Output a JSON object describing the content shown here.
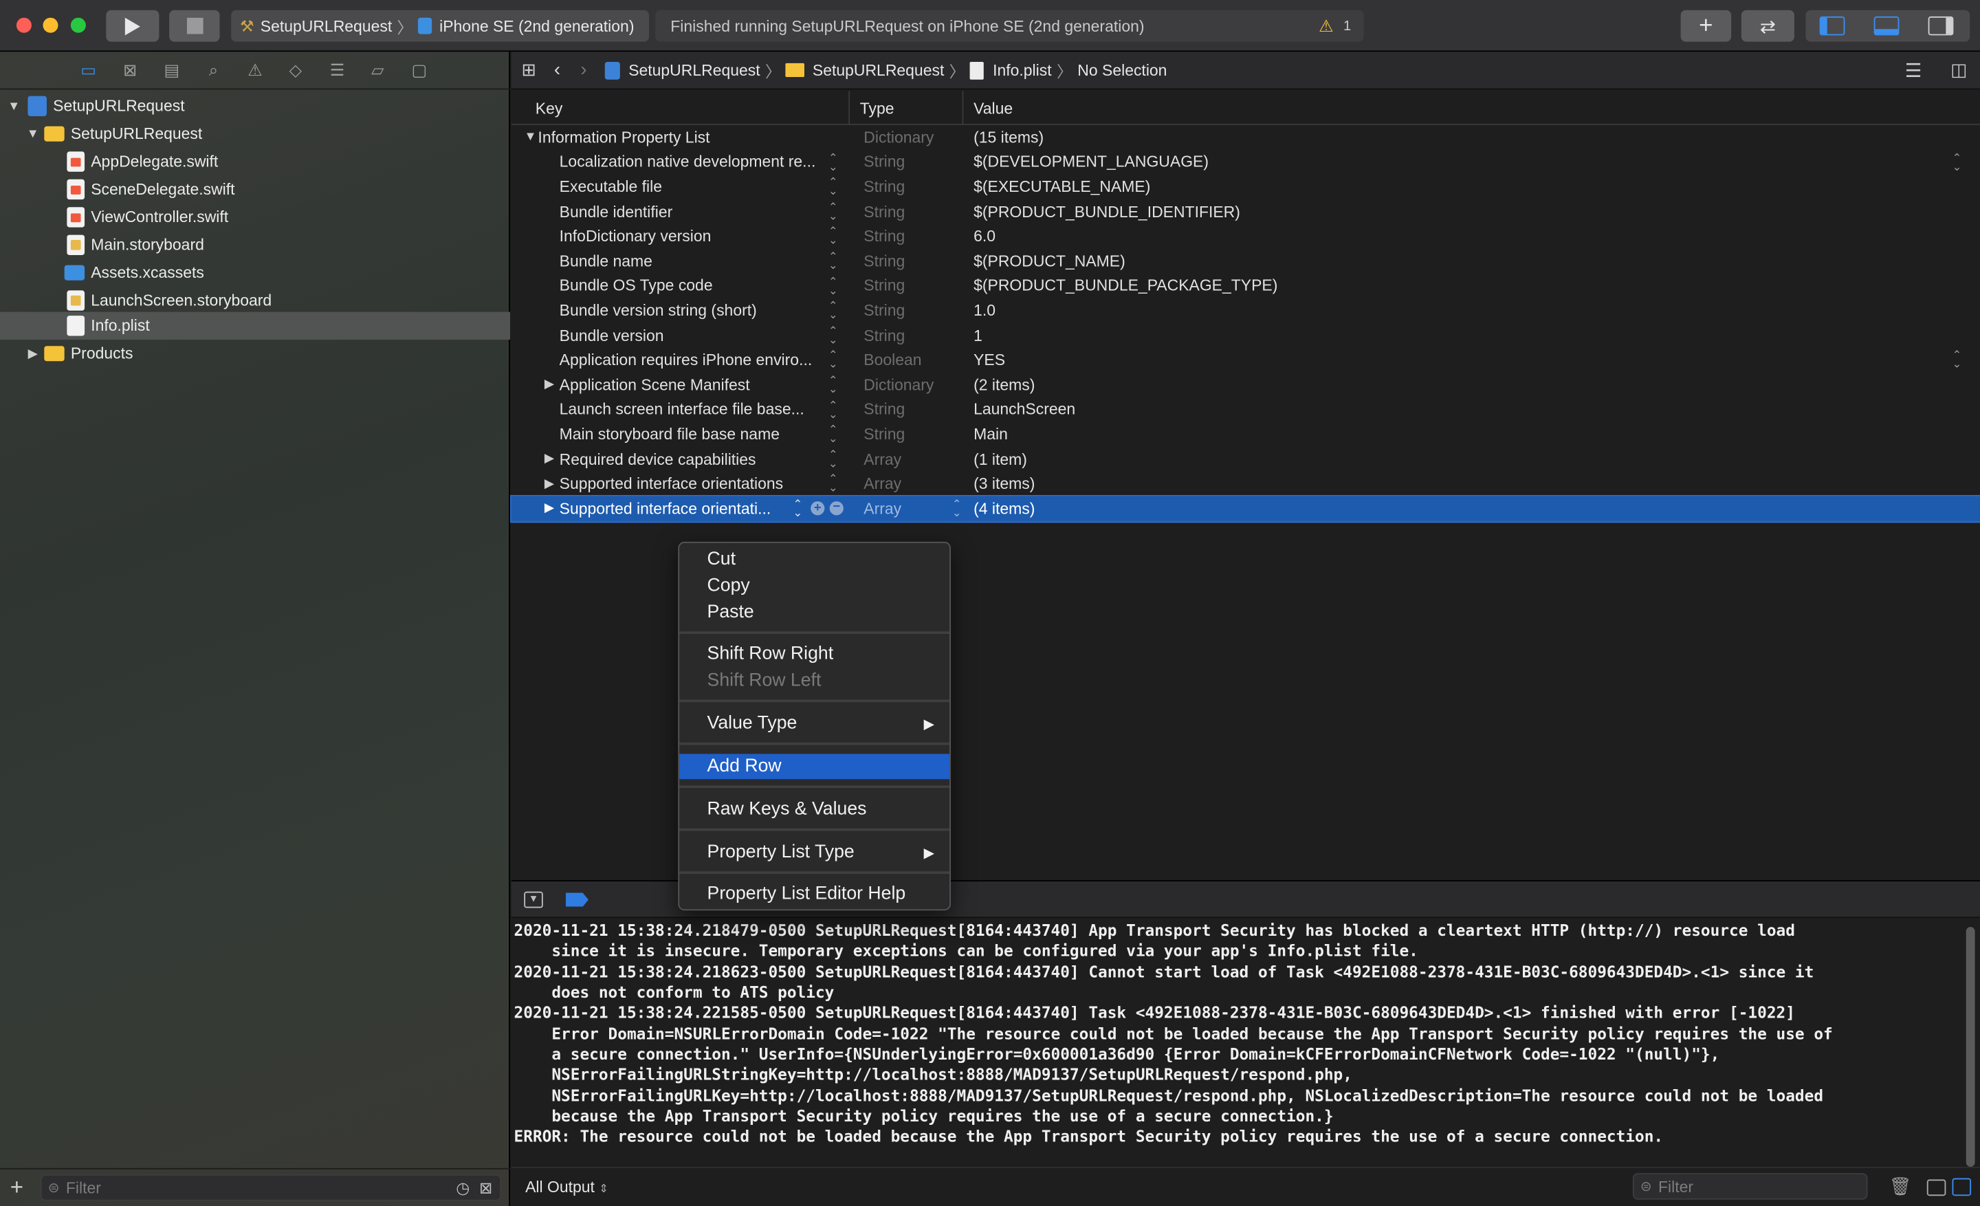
{
  "toolbar": {
    "scheme_target": "SetupURLRequest",
    "scheme_device": "iPhone SE (2nd generation)",
    "status_text": "Finished running SetupURLRequest on iPhone SE (2nd generation)",
    "warning_count": "1",
    "run_icon": "play-icon",
    "stop_icon": "stop-icon"
  },
  "navigator": {
    "icons": [
      "folder-icon",
      "source-control-icon",
      "symbol-icon",
      "search-icon",
      "issue-icon",
      "test-icon",
      "debug-icon",
      "breakpoint-icon",
      "report-icon"
    ],
    "tree": [
      {
        "label": "SetupURLRequest",
        "kind": "proj"
      },
      {
        "label": "SetupURLRequest",
        "kind": "folder"
      },
      {
        "label": "AppDelegate.swift",
        "kind": "swift"
      },
      {
        "label": "SceneDelegate.swift",
        "kind": "swift"
      },
      {
        "label": "ViewController.swift",
        "kind": "swift"
      },
      {
        "label": "Main.storyboard",
        "kind": "sb"
      },
      {
        "label": "Assets.xcassets",
        "kind": "assets"
      },
      {
        "label": "LaunchScreen.storyboard",
        "kind": "sb"
      },
      {
        "label": "Info.plist",
        "kind": "doc"
      },
      {
        "label": "Products",
        "kind": "folder"
      }
    ],
    "filter_placeholder": "Filter"
  },
  "jumpbar": {
    "crumbs": [
      "SetupURLRequest",
      "SetupURLRequest",
      "Info.plist",
      "No Selection"
    ]
  },
  "plist": {
    "headers": {
      "key": "Key",
      "type": "Type",
      "value": "Value"
    },
    "root": {
      "key": "Information Property List",
      "type": "Dictionary",
      "value": "(15 items)"
    },
    "rows": [
      {
        "key": "Localization native development re...",
        "type": "String",
        "value": "$(DEVELOPMENT_LANGUAGE)"
      },
      {
        "key": "Executable file",
        "type": "String",
        "value": "$(EXECUTABLE_NAME)"
      },
      {
        "key": "Bundle identifier",
        "type": "String",
        "value": "$(PRODUCT_BUNDLE_IDENTIFIER)"
      },
      {
        "key": "InfoDictionary version",
        "type": "String",
        "value": "6.0"
      },
      {
        "key": "Bundle name",
        "type": "String",
        "value": "$(PRODUCT_NAME)"
      },
      {
        "key": "Bundle OS Type code",
        "type": "String",
        "value": "$(PRODUCT_BUNDLE_PACKAGE_TYPE)"
      },
      {
        "key": "Bundle version string (short)",
        "type": "String",
        "value": "1.0"
      },
      {
        "key": "Bundle version",
        "type": "String",
        "value": "1"
      },
      {
        "key": "Application requires iPhone enviro...",
        "type": "Boolean",
        "value": "YES"
      },
      {
        "key": "Application Scene Manifest",
        "type": "Dictionary",
        "value": "(2 items)"
      },
      {
        "key": "Launch screen interface file base...",
        "type": "String",
        "value": "LaunchScreen"
      },
      {
        "key": "Main storyboard file base name",
        "type": "String",
        "value": "Main"
      },
      {
        "key": "Required device capabilities",
        "type": "Array",
        "value": "(1 item)"
      },
      {
        "key": "Supported interface orientations",
        "type": "Array",
        "value": "(3 items)"
      },
      {
        "key": "Supported interface orientati...",
        "type": "Array",
        "value": "(4 items)"
      }
    ]
  },
  "context_menu": {
    "items": [
      "Cut",
      "Copy",
      "Paste",
      "Shift Row Right",
      "Shift Row Left",
      "Value Type",
      "Add Row",
      "Raw Keys & Values",
      "Property List Type",
      "Property List Editor Help"
    ]
  },
  "console": {
    "lines": [
      "2020-11-21 15:38:24.218479-0500 SetupURLRequest[8164:443740] App Transport Security has blocked a cleartext HTTP (http://) resource load",
      "    since it is insecure. Temporary exceptions can be configured via your app's Info.plist file.",
      "2020-11-21 15:38:24.218623-0500 SetupURLRequest[8164:443740] Cannot start load of Task <492E1088-2378-431E-B03C-6809643DED4D>.<1> since it",
      "    does not conform to ATS policy",
      "2020-11-21 15:38:24.221585-0500 SetupURLRequest[8164:443740] Task <492E1088-2378-431E-B03C-6809643DED4D>.<1> finished with error [-1022]",
      "    Error Domain=NSURLErrorDomain Code=-1022 \"The resource could not be loaded because the App Transport Security policy requires the use of",
      "    a secure connection.\" UserInfo={NSUnderlyingError=0x600001a36d90 {Error Domain=kCFErrorDomainCFNetwork Code=-1022 \"(null)\"},",
      "    NSErrorFailingURLStringKey=http://localhost:8888/MAD9137/SetupURLRequest/respond.php,",
      "    NSErrorFailingURLKey=http://localhost:8888/MAD9137/SetupURLRequest/respond.php, NSLocalizedDescription=The resource could not be loaded",
      "    because the App Transport Security policy requires the use of a secure connection.}",
      "ERROR: The resource could not be loaded because the App Transport Security policy requires the use of a secure connection."
    ],
    "output_selector": "All Output",
    "filter_placeholder": "Filter"
  },
  "colors": {
    "accent": "#1f5fc8",
    "selection": "#1d5baf",
    "warning": "#f5c33a"
  }
}
